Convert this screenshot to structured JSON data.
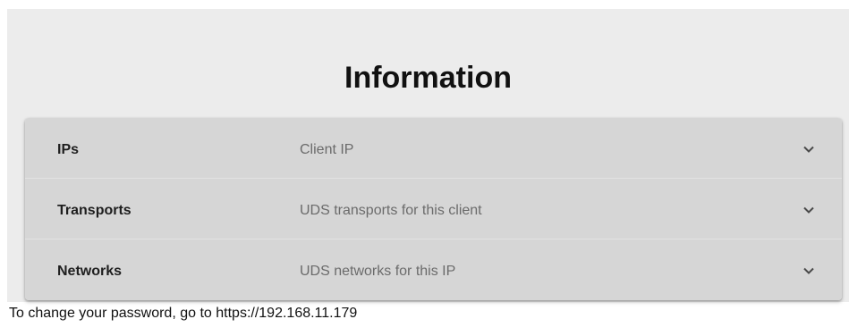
{
  "page": {
    "title": "Information",
    "footer": "To change your password, go to https://192.168.11.179"
  },
  "sections": [
    {
      "name": "IPs",
      "description": "Client IP",
      "icon": "chevron-down-icon"
    },
    {
      "name": "Transports",
      "description": "UDS transports for this client",
      "icon": "chevron-down-icon"
    },
    {
      "name": "Networks",
      "description": "UDS networks for this IP",
      "icon": "chevron-down-icon"
    }
  ]
}
